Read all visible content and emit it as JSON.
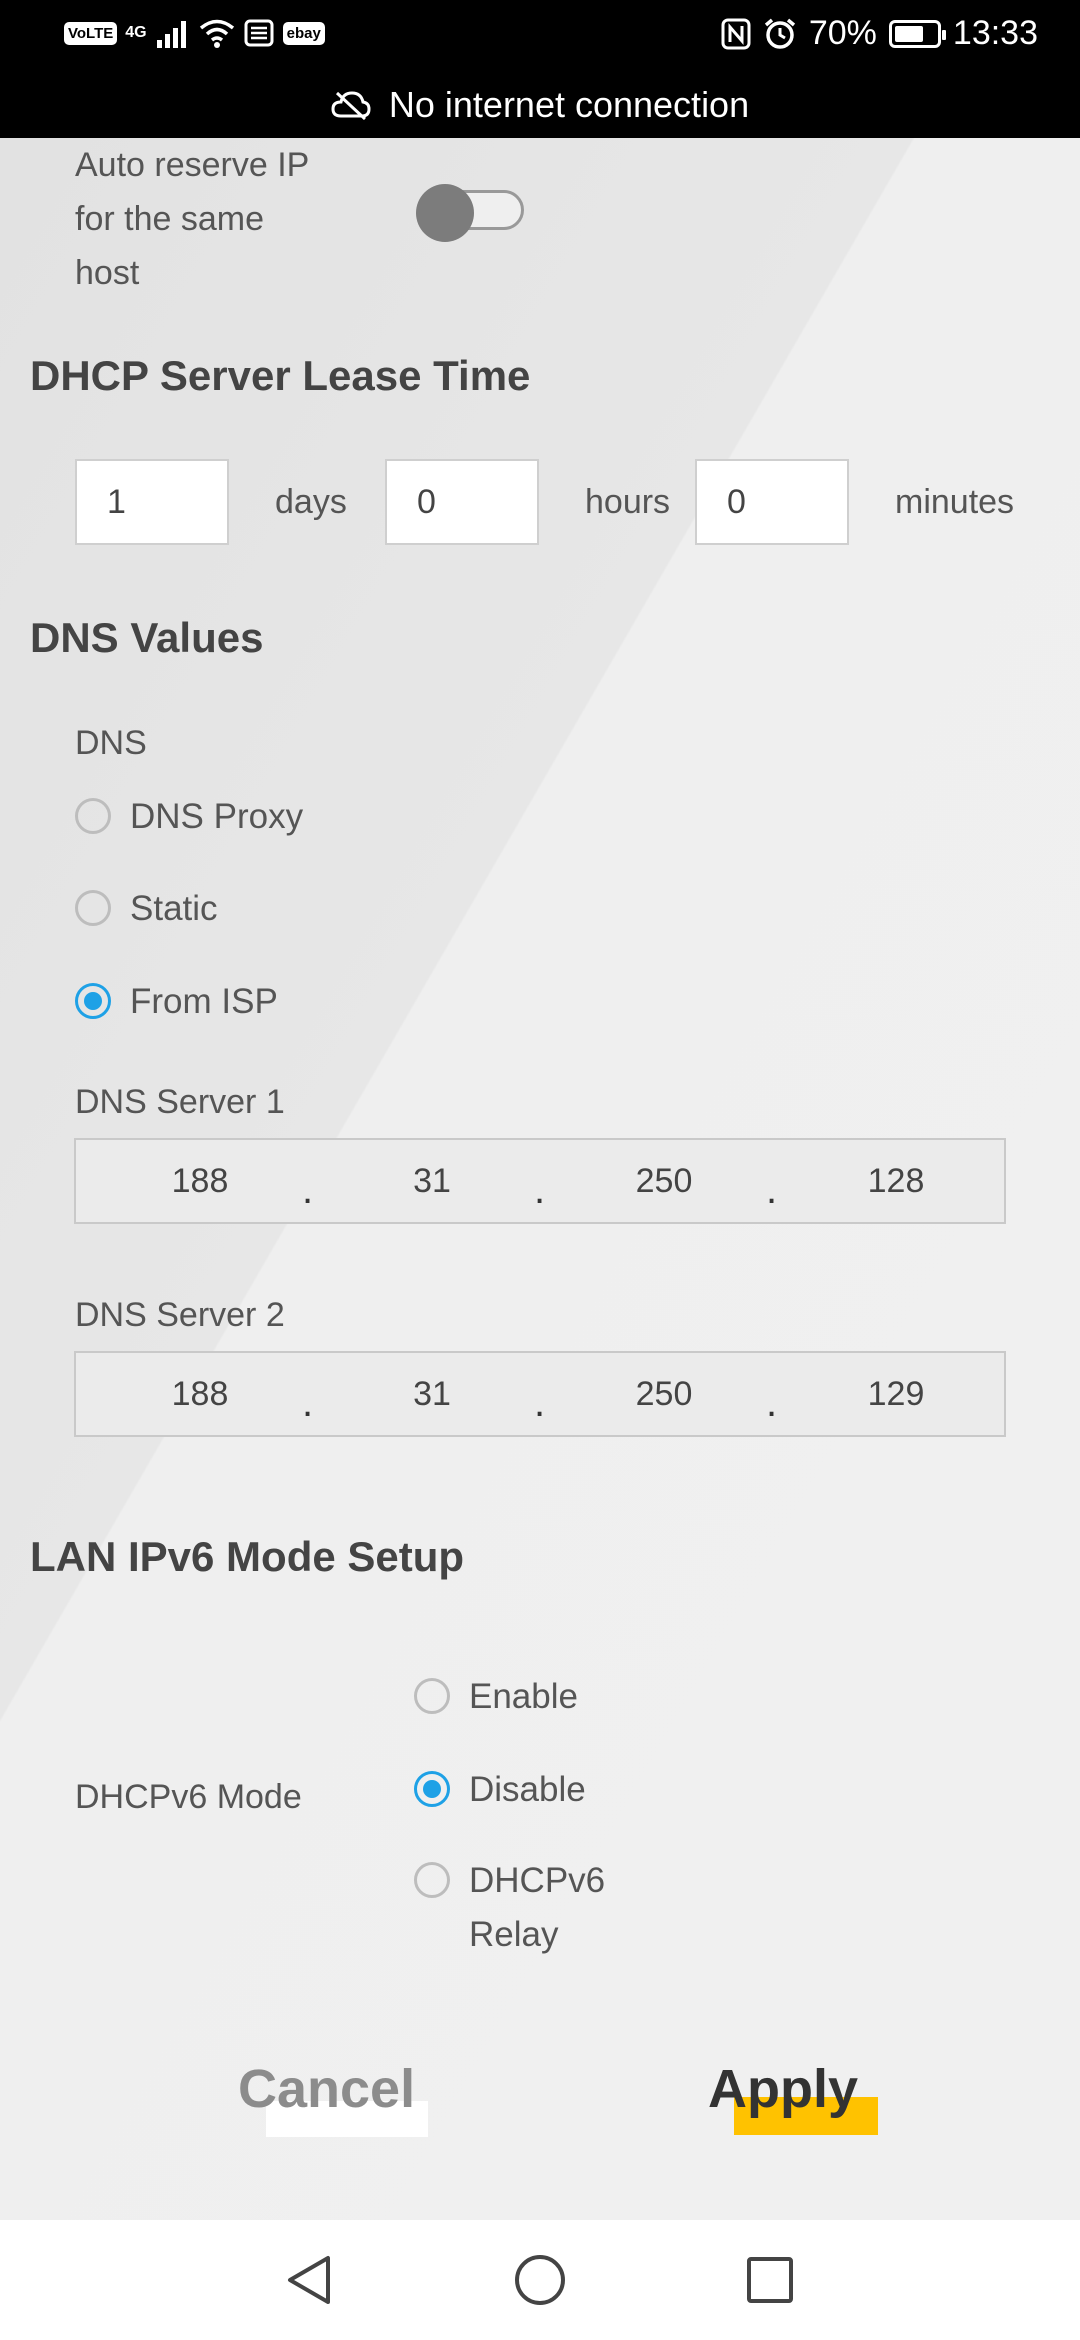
{
  "status_bar": {
    "volte": "VoLTE",
    "network": "4G",
    "app_badge": "ebay",
    "battery": "70%",
    "time": "13:33",
    "notice": "No internet connection"
  },
  "auto_reserve": {
    "label_lines": [
      "Auto reserve IP",
      "for the same",
      "host"
    ],
    "enabled": false
  },
  "lease_time": {
    "heading": "DHCP Server Lease Time",
    "days_value": "1",
    "days_label": "days",
    "hours_value": "0",
    "hours_label": "hours",
    "minutes_value": "0",
    "minutes_label": "minutes"
  },
  "dns": {
    "heading": "DNS Values",
    "label": "DNS",
    "options": [
      "DNS Proxy",
      "Static",
      "From ISP"
    ],
    "selected": "From ISP",
    "server1_label": "DNS Server 1",
    "server1": [
      "188",
      "31",
      "250",
      "128"
    ],
    "server2_label": "DNS Server 2",
    "server2": [
      "188",
      "31",
      "250",
      "129"
    ],
    "dot": "."
  },
  "ipv6": {
    "heading": "LAN IPv6 Mode Setup",
    "mode_label": "DHCPv6 Mode",
    "options": [
      "Enable",
      "Disable",
      "DHCPv6"
    ],
    "relay_line": "Relay",
    "selected": "Disable"
  },
  "actions": {
    "cancel": "Cancel",
    "apply": "Apply",
    "accent": "#ffc200"
  }
}
